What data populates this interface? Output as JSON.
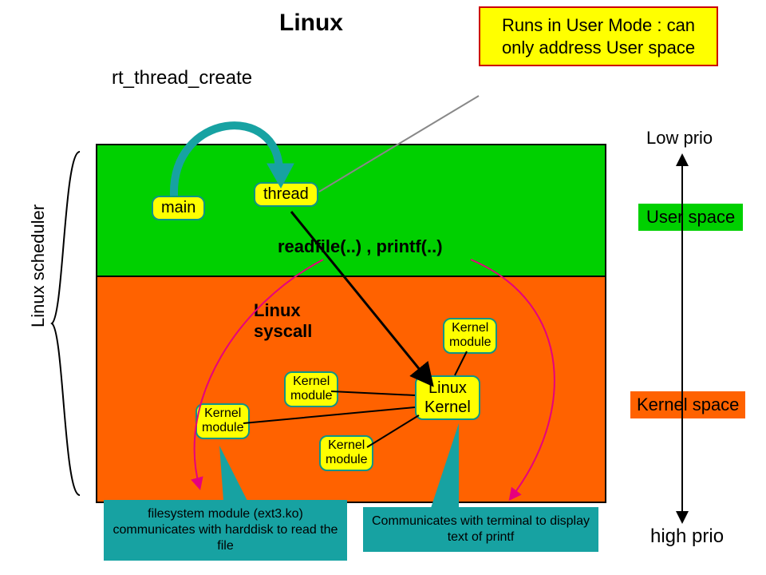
{
  "title": "Linux",
  "create_label": "rt_thread_create",
  "usermode_callout": "Runs in User Mode : can only address User space",
  "low_prio": "Low prio",
  "high_prio": "high prio",
  "userspace": "User space",
  "kernelspace": "Kernel space",
  "boxes": {
    "main": "main",
    "thread": "thread",
    "linux_kernel": "Linux Kernel",
    "km1": "Kernel module",
    "km2": "Kernel module",
    "km3": "Kernel module",
    "km4": "Kernel module"
  },
  "readfile_label": "readfile(..) , printf(..)",
  "syscall_label": "Linux syscall",
  "scheduler_label": "Linux scheduler",
  "fs_callout": "filesystem module (ext3.ko) communicates with harddisk to read the file",
  "term_callout": "Communicates with terminal to display text of printf"
}
